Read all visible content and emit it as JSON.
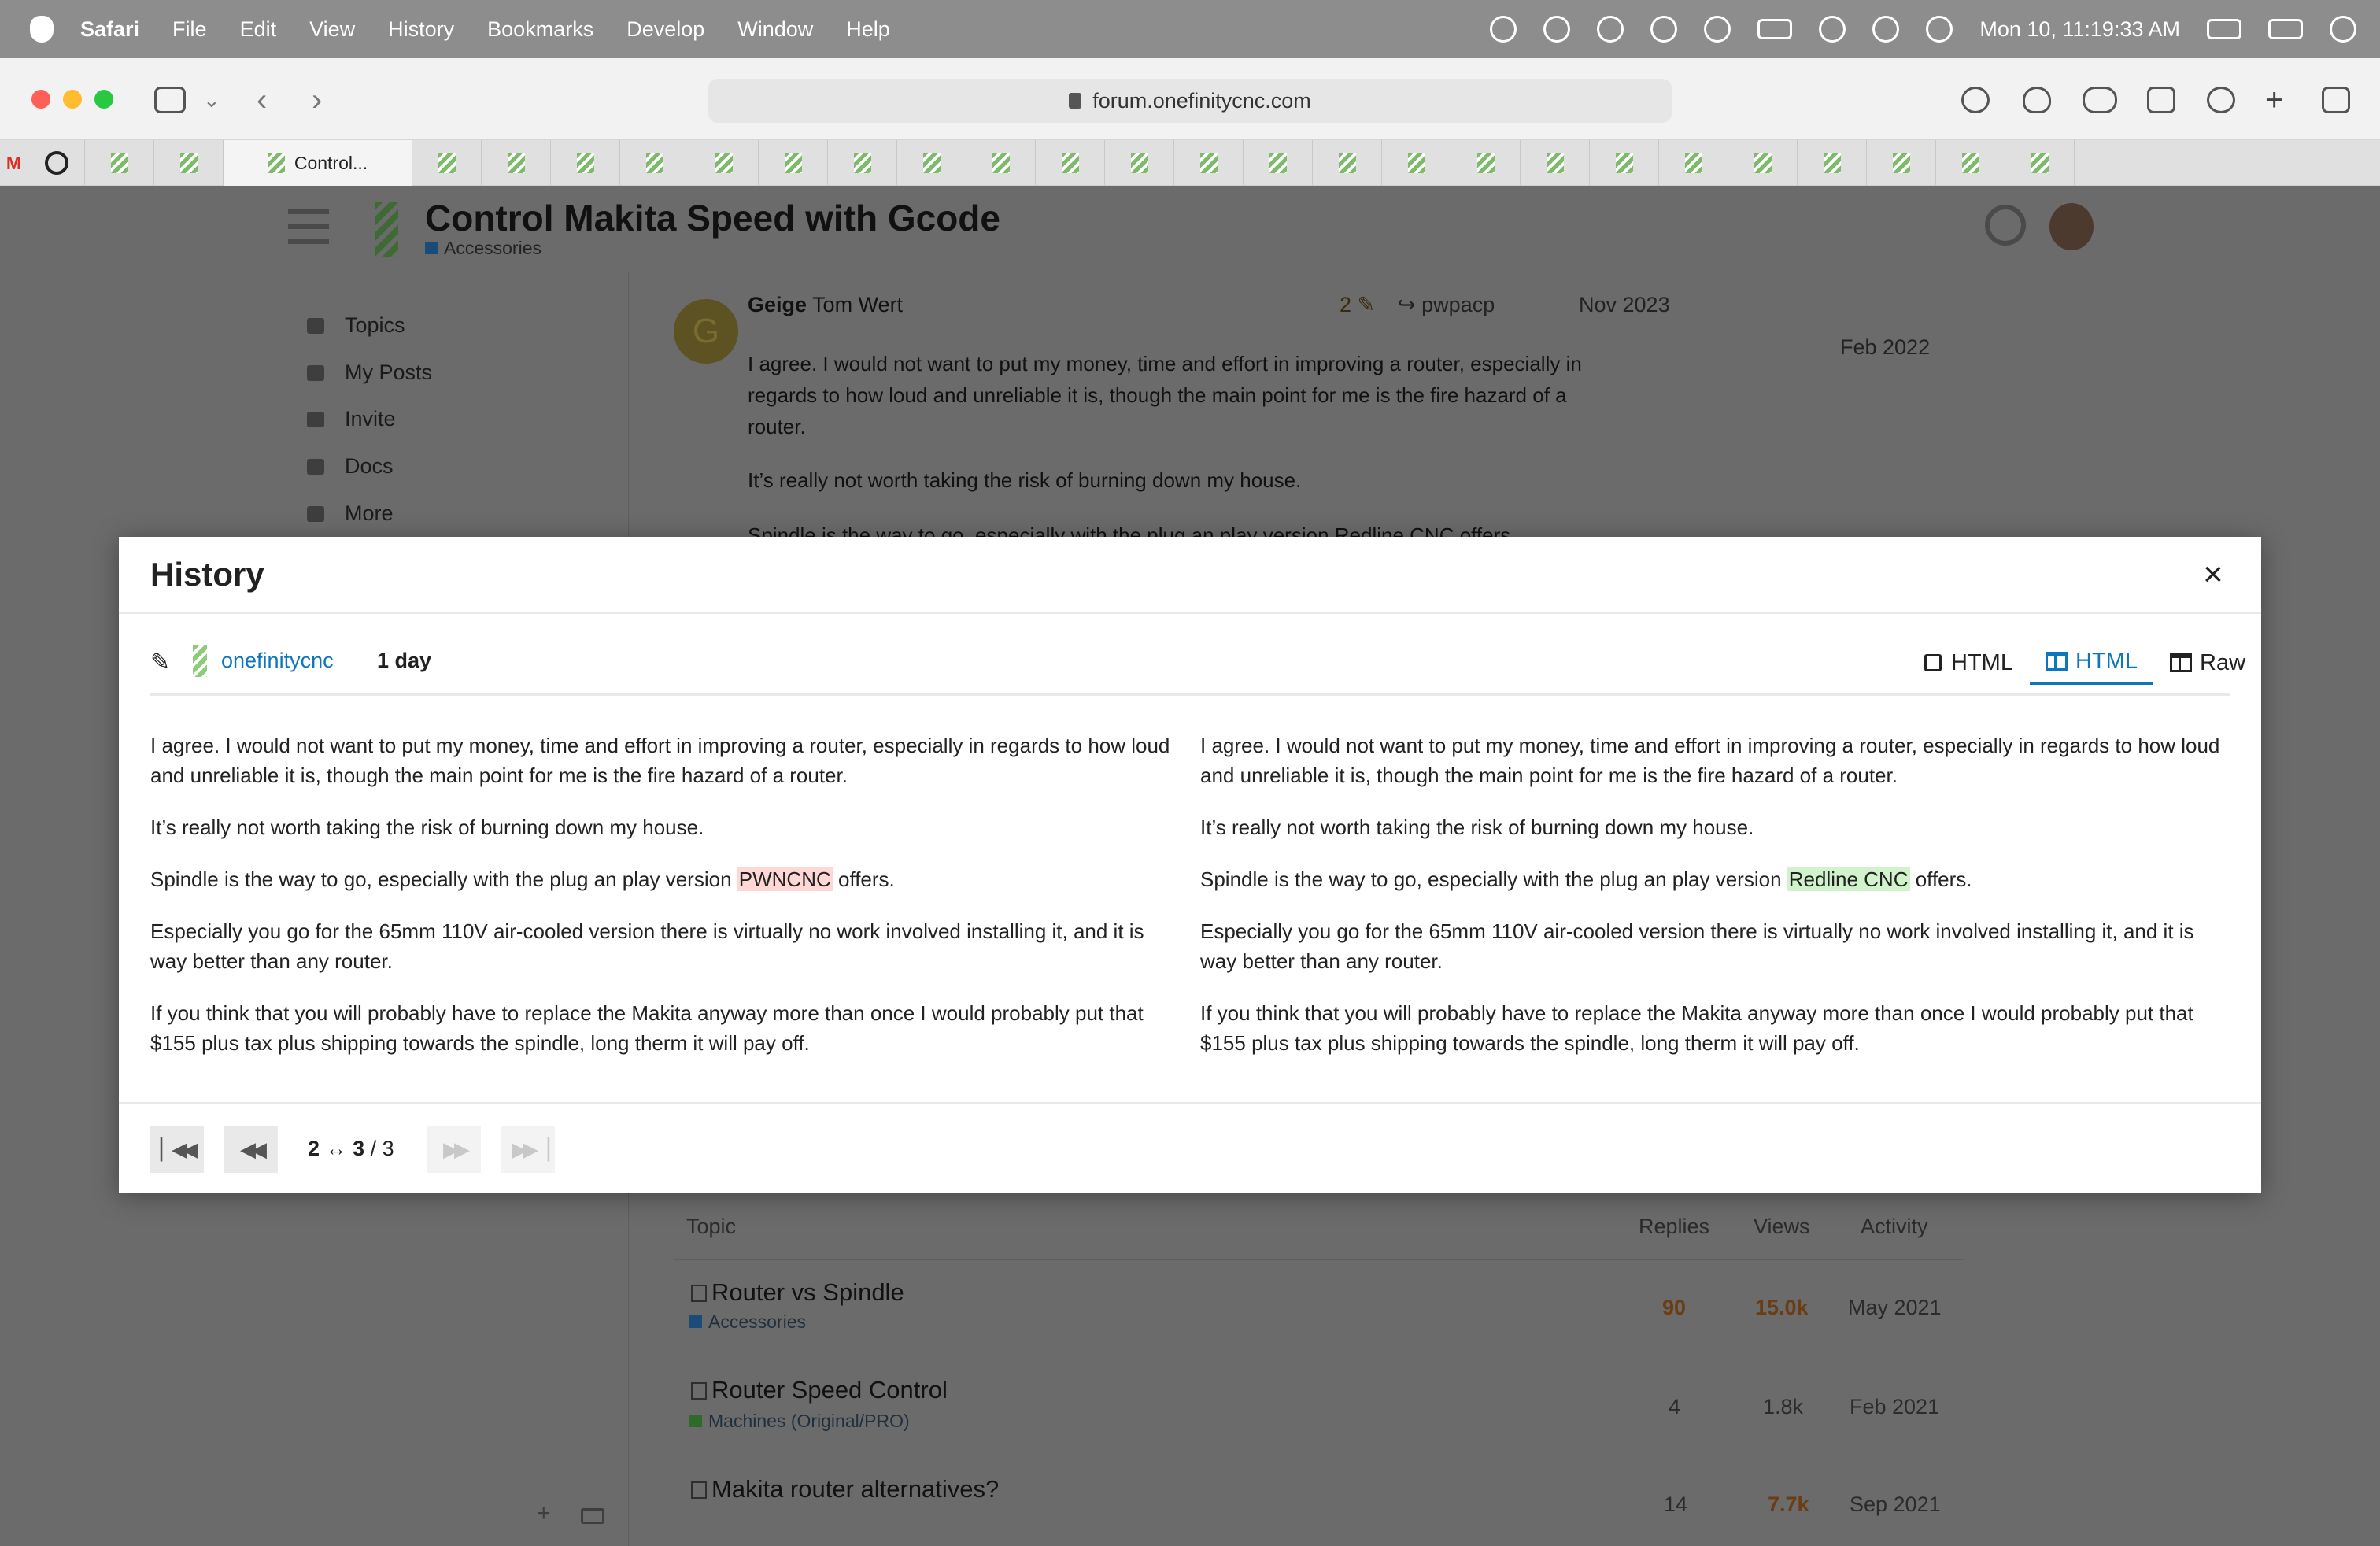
{
  "menubar": {
    "app": "Safari",
    "items": [
      "File",
      "Edit",
      "View",
      "History",
      "Bookmarks",
      "Develop",
      "Window",
      "Help"
    ],
    "clock": "Mon 10, 11:19:33 AM"
  },
  "browser": {
    "url": "forum.onefinitycnc.com",
    "active_tab": "Control..."
  },
  "page": {
    "title": "Control Makita Speed with Gcode",
    "category": "Accessories",
    "sidebar": [
      "Topics",
      "My Posts",
      "Invite",
      "Docs",
      "More"
    ],
    "post": {
      "avatar_letter": "G",
      "username": "Geige",
      "fullname": "Tom Wert",
      "edits": "2",
      "reply_to": "pwpacp",
      "date": "Nov 2023",
      "timeline_date": "Feb 2022",
      "paragraphs": [
        "I agree. I would not want to put my money, time and effort in improving a router, especially in",
        "regards to how loud and unreliable it is, though the main point for me is the fire hazard of a",
        "router.",
        "It’s really not worth taking the risk of burning down my house.",
        "Spindle is the way to go, especially with the plug an play version Redline CNC offers."
      ]
    },
    "topics": {
      "headers": {
        "topic": "Topic",
        "replies": "Replies",
        "views": "Views",
        "activity": "Activity"
      },
      "rows": [
        {
          "title": "Router vs Spindle",
          "category": "Accessories",
          "cat_color": "#1b4b78",
          "replies": "90",
          "views": "15.0k",
          "activity": "May 2021",
          "hot": true
        },
        {
          "title": "Router Speed Control",
          "category": "Machines (Original/PRO)",
          "cat_color": "#2e6b2b",
          "replies": "4",
          "views": "1.8k",
          "activity": "Feb 2021",
          "hot": false
        },
        {
          "title": "Makita router alternatives?",
          "category": "",
          "cat_color": "",
          "replies": "14",
          "views": "7.7k",
          "activity": "Sep 2021",
          "hot": true
        }
      ]
    }
  },
  "modal": {
    "title": "History",
    "close": "×",
    "revision_user": "onefinitycnc",
    "revision_time": "1 day",
    "views": [
      "HTML",
      "HTML",
      "Raw"
    ],
    "left": {
      "p1": "I agree. I would not want to put my money, time and effort in improving a router, especially in regards to how loud and unreliable it is, though the main point for me is the fire hazard of a router.",
      "p2": "It’s really not worth taking the risk of burning down my house.",
      "p3_pre": "Spindle is the way to go, especially with the plug an play version ",
      "p3_changed": "PWNCNC",
      "p3_post": " offers.",
      "p4": "Especially you go for the 65mm 110V air-cooled version there is virtually no work involved installing it, and it is way better than any router.",
      "p5": "If you think that you will probably have to replace the Makita anyway more than once I would probably put that $155 plus tax plus shipping towards the spindle, long therm it will pay off."
    },
    "right": {
      "p1": "I agree. I would not want to put my money, time and effort in improving a router, especially in regards to how loud and unreliable it is, though the main point for me is the fire hazard of a router.",
      "p2": "It’s really not worth taking the risk of burning down my house.",
      "p3_pre": "Spindle is the way to go, especially with the plug an play version ",
      "p3_changed": "Redline CNC",
      "p3_post": " offers.",
      "p4": "Especially you go for the 65mm 110V air-cooled version there is virtually no work involved installing it, and it is way better than any router.",
      "p5": "If you think that you will probably have to replace the Makita anyway more than once I would probably put that $155 plus tax plus shipping towards the spindle, long therm it will pay off."
    },
    "pager": {
      "from": "2",
      "arrow": "↔",
      "to": "3",
      "sep": " / ",
      "total": "3"
    },
    "colors": {
      "deleted": "#ffd8d5",
      "inserted": "#d1f3cc",
      "link": "#0e76bd"
    }
  }
}
